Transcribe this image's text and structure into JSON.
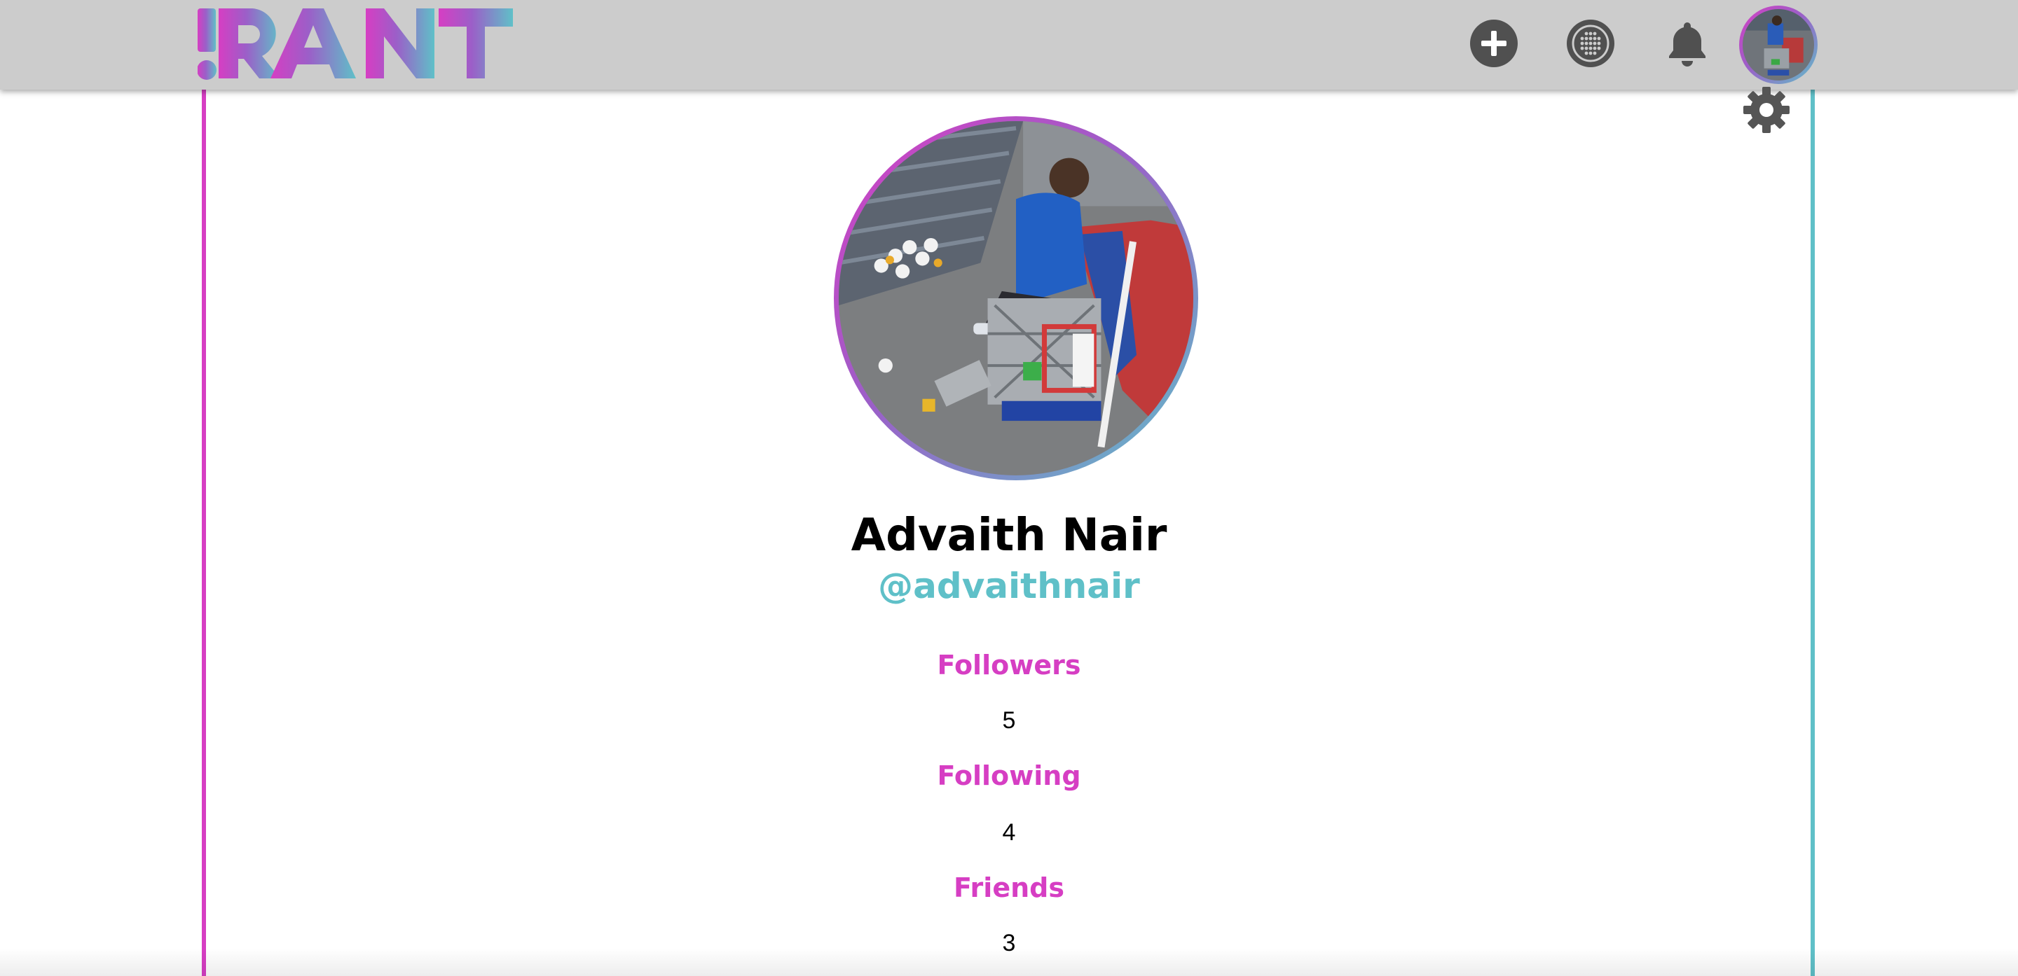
{
  "brand": {
    "logo_text": "!RANT",
    "colors": {
      "pink": "#d63ec3",
      "purple": "#9b5fc8",
      "teal": "#5fc0c8"
    }
  },
  "nav": {
    "icons": [
      "add-post-icon",
      "explore-icon",
      "notifications-bell-icon",
      "user-avatar"
    ]
  },
  "profile": {
    "name": "Advaith Nair",
    "handle": "@advaithnair",
    "settings_icon": "gear-icon",
    "stats": [
      {
        "label": "Followers",
        "value": "5"
      },
      {
        "label": "Following",
        "value": "4"
      },
      {
        "label": "Friends",
        "value": "3"
      }
    ]
  }
}
